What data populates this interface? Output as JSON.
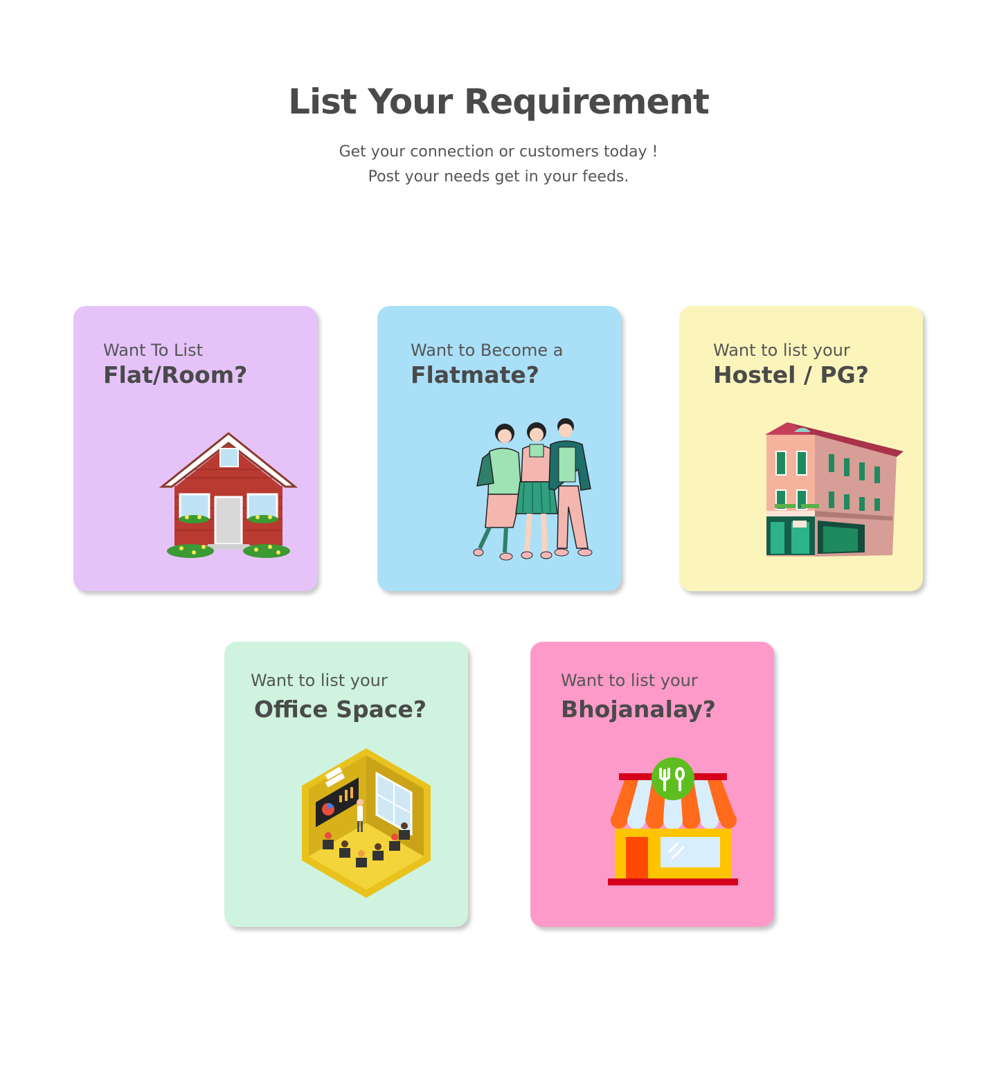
{
  "header": {
    "title": "List Your Requirement",
    "subtitle_line1": "Get your connection or customers today !",
    "subtitle_line2": "Post your needs get in your feeds."
  },
  "cards": [
    {
      "pre": "Want To List",
      "main": "Flat/Room?",
      "color": "#e5c3f9",
      "icon": "house-icon"
    },
    {
      "pre": "Want to Become a",
      "main": "Flatmate?",
      "color": "#aadff8",
      "icon": "people-icon"
    },
    {
      "pre": "Want to list your",
      "main": "Hostel / PG?",
      "color": "#fbf5bc",
      "icon": "building-icon"
    },
    {
      "pre": "Want to list your",
      "main": "Office Space?",
      "color": "#cff3de",
      "icon": "office-icon"
    },
    {
      "pre": "Want to list your",
      "main": "Bhojanalay?",
      "color": "#fd9ac9",
      "icon": "restaurant-icon"
    }
  ]
}
